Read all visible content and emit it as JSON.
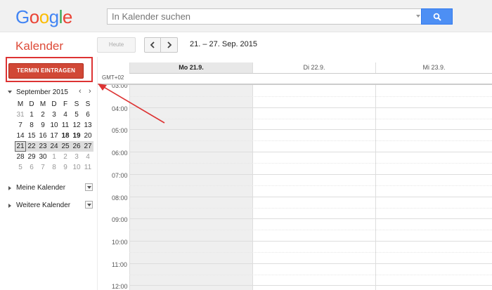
{
  "logo": {
    "letters": [
      "G",
      "o",
      "o",
      "g",
      "l",
      "e"
    ],
    "colors": [
      "#4285f4",
      "#ea4335",
      "#fbbc05",
      "#4285f4",
      "#34a853",
      "#ea4335"
    ]
  },
  "search": {
    "placeholder": "In Kalender suchen",
    "icon": "magnifier-icon"
  },
  "app_title": "Kalender",
  "toolbar": {
    "today_label": "Heute",
    "prev_icon": "chevron-left-icon",
    "next_icon": "chevron-right-icon",
    "range": "21. – 27. Sep. 2015"
  },
  "create_button": "TERMIN EINTRAGEN",
  "mini_calendar": {
    "month": "September 2015",
    "weekdays": [
      "M",
      "D",
      "M",
      "D",
      "F",
      "S",
      "S"
    ],
    "weeks": [
      [
        "31",
        "1",
        "2",
        "3",
        "4",
        "5",
        "6"
      ],
      [
        "7",
        "8",
        "9",
        "10",
        "11",
        "12",
        "13"
      ],
      [
        "14",
        "15",
        "16",
        "17",
        "18",
        "19",
        "20"
      ],
      [
        "21",
        "22",
        "23",
        "24",
        "25",
        "26",
        "27"
      ],
      [
        "28",
        "29",
        "30",
        "1",
        "2",
        "3",
        "4"
      ],
      [
        "5",
        "6",
        "7",
        "8",
        "9",
        "10",
        "11"
      ]
    ]
  },
  "sections": {
    "my_calendars": "Meine Kalender",
    "other_calendars": "Weitere Kalender"
  },
  "grid": {
    "days": [
      "Mo 21.9.",
      "Di 22.9.",
      "Mi 23.9."
    ],
    "timezone": "GMT+02",
    "times": [
      "03:00",
      "04:00",
      "05:00",
      "06:00",
      "07:00",
      "08:00",
      "09:00",
      "10:00",
      "11:00",
      "12:00"
    ]
  },
  "accent": {
    "red": "#dd4b39",
    "button": "#d14836",
    "search_blue": "#4d8ff4"
  }
}
